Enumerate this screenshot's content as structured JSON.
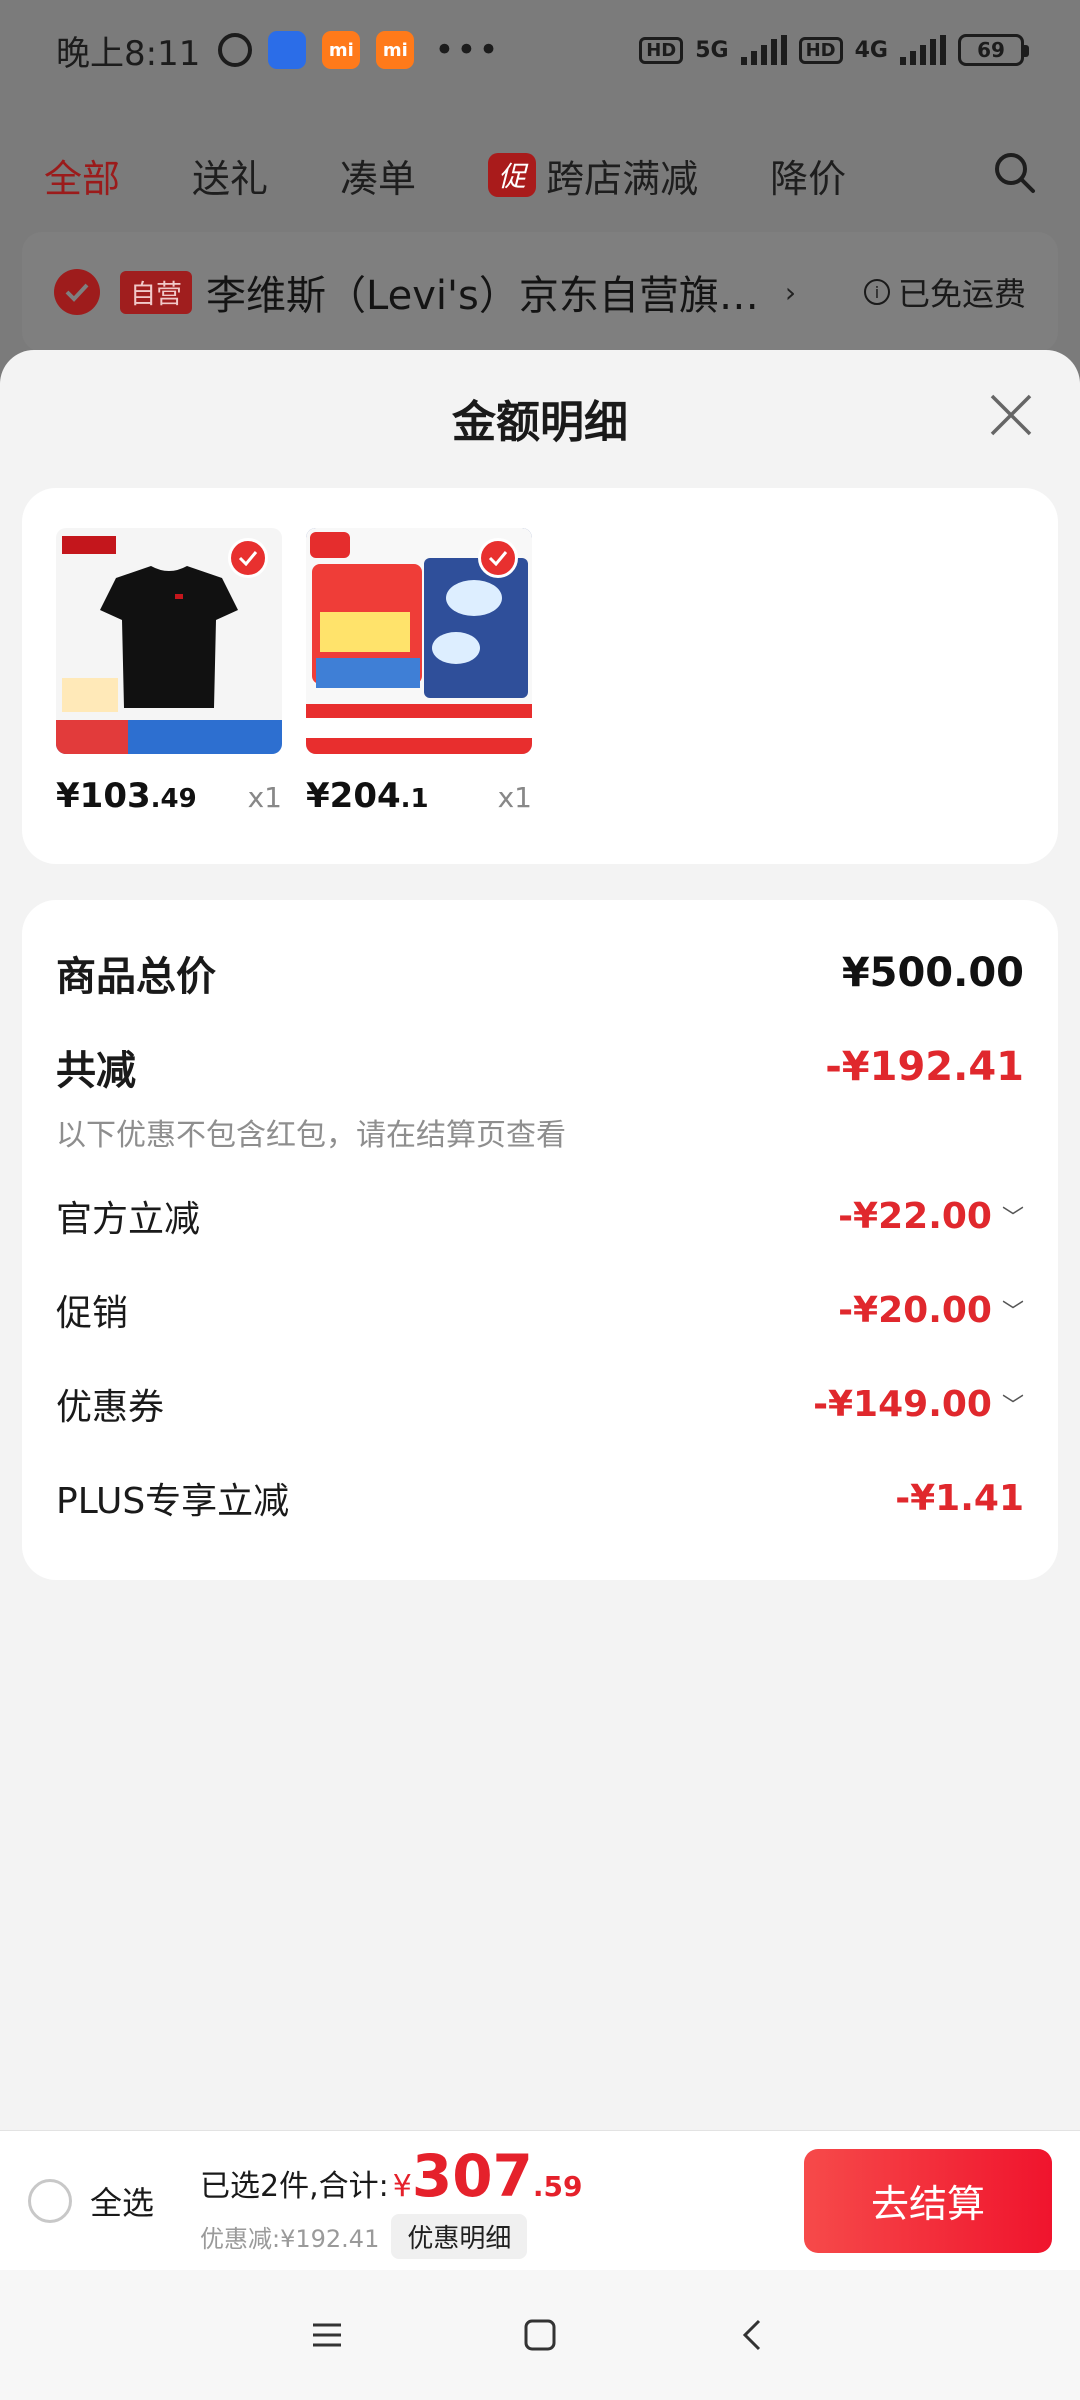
{
  "status_bar": {
    "time": "晚上8:11",
    "more": "•••",
    "hd1": "HD",
    "net1": "5G",
    "hd2": "HD",
    "net2": "4G",
    "battery": "69"
  },
  "top_tabs": {
    "all": "全部",
    "gift": "送礼",
    "bundle": "凑单",
    "promo_badge": "促",
    "cross_store": "跨店满减",
    "price_drop": "降价"
  },
  "store": {
    "self_badge": "自营",
    "name": "李维斯（Levi's）京东自营旗…",
    "arrow": "›",
    "shipping": "已免运费",
    "info": "i"
  },
  "sheet": {
    "title": "金额明细",
    "items": [
      {
        "price_int": "¥103",
        "price_dec": ".49",
        "qty": "x1"
      },
      {
        "price_int": "¥204",
        "price_dec": ".1",
        "qty": "x1"
      }
    ],
    "details": {
      "total_label": "商品总价",
      "total_value": "¥500.00",
      "reduce_label": "共减",
      "reduce_value": "-¥192.41",
      "note": "以下优惠不包含红包，请在结算页查看",
      "official_label": "官方立减",
      "official_value": "-¥22.00",
      "promo_label": "促销",
      "promo_value": "-¥20.00",
      "coupon_label": "优惠券",
      "coupon_value": "-¥149.00",
      "plus_label": "PLUS专享立减",
      "plus_value": "-¥1.41"
    }
  },
  "bottom": {
    "select_all": "全选",
    "selected_text": "已选2件,合计:",
    "yen": "¥",
    "total_int": "307",
    "total_dec": ".59",
    "discount_text": "优惠减:¥192.41",
    "detail_btn": "优惠明细",
    "checkout": "去结算"
  },
  "colors": {
    "accent_red": "#e0282d",
    "checkout_red": "#f0142d"
  },
  "icons": {
    "search": "search-icon",
    "close": "close-icon",
    "menu": "menu-icon",
    "home": "home-icon",
    "back": "back-icon"
  }
}
